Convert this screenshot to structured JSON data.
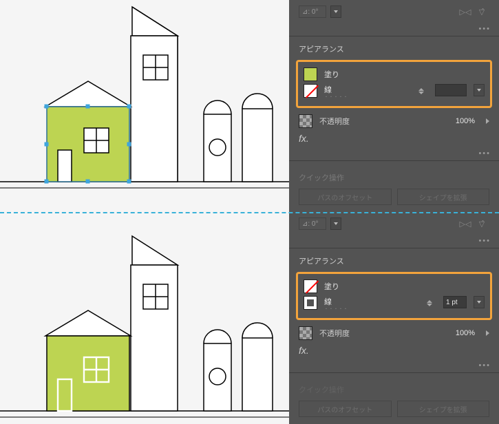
{
  "transform": {
    "angle_label": "⊿: 0°",
    "flip_h_icon": "flip-horizontal",
    "flip_v_icon": "flip-vertical"
  },
  "appearance": {
    "header": "アピアランス",
    "fill_label": "塗り",
    "stroke_label": "線",
    "opacity_label": "不透明度",
    "opacity_value": "100%",
    "fx_label": "fx.",
    "stroke_link_dots": "・・・・・"
  },
  "panel1": {
    "fill_color": "#bdd452",
    "stroke_none": true,
    "stroke_width": ""
  },
  "panel2": {
    "fill_none": true,
    "stroke_color": "#ffffff",
    "stroke_width": "1 pt"
  },
  "quick": {
    "header": "クイック操作",
    "offset_btn": "パスのオフセット",
    "expand_btn": "シェイプを拡張"
  },
  "colors": {
    "house_fill": "#bdd452",
    "outline": "#000000",
    "highlight": "#f2a33c",
    "selection": "#3ea5dd"
  }
}
